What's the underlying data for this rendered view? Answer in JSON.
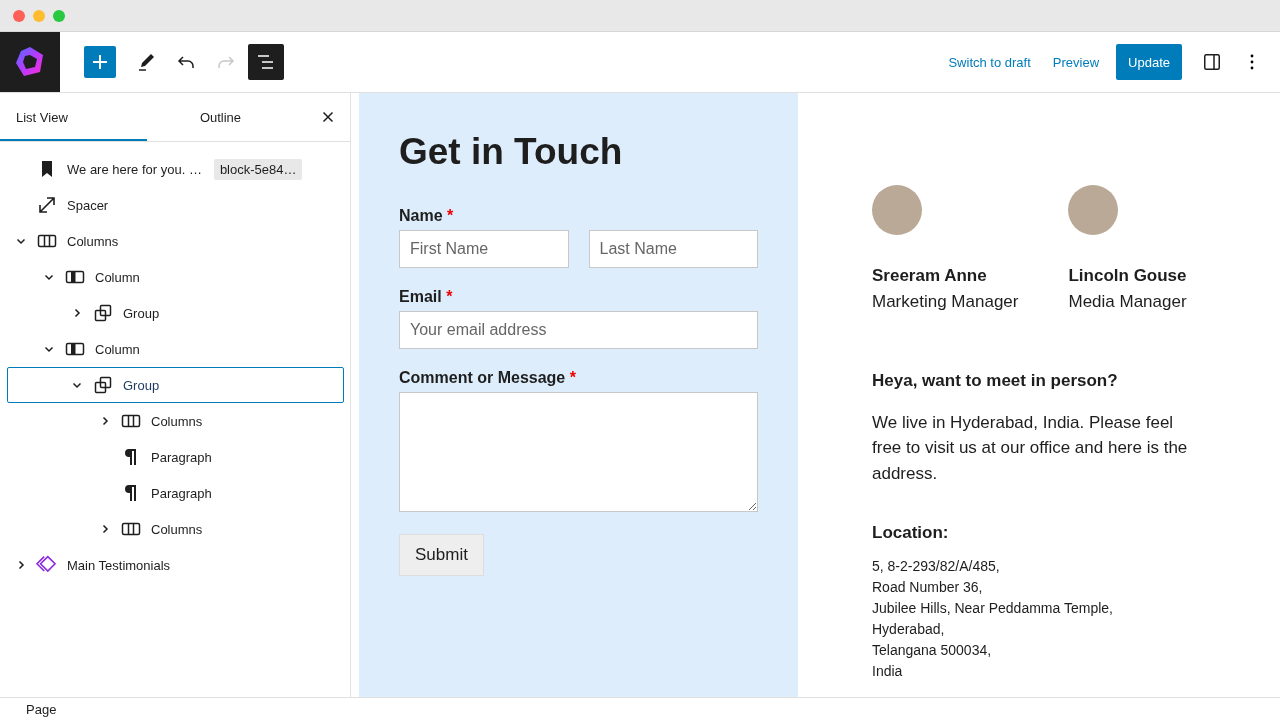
{
  "toolbar": {
    "list_view_active": true,
    "redo_disabled": true,
    "links": [
      "Switch to draft",
      "Preview"
    ],
    "primary_button": "Update"
  },
  "sidebar": {
    "tabs": [
      {
        "label": "List View",
        "selected": true
      },
      {
        "label": "Outline",
        "selected": false
      }
    ],
    "tree": [
      {
        "label": "We are here for you. …",
        "kind": "bookmark",
        "badge": "block-5e84…",
        "selected": false
      },
      {
        "label": "Spacer",
        "kind": "spacer",
        "selected": false
      },
      {
        "label": "Columns",
        "kind": "columns",
        "expanded": true,
        "selected": false,
        "children": [
          {
            "label": "Column",
            "kind": "column",
            "expanded": true,
            "selected": false,
            "children": [
              {
                "label": "Group",
                "kind": "group",
                "expanded": false,
                "selected": false
              }
            ]
          },
          {
            "label": "Column",
            "kind": "column",
            "expanded": true,
            "selected": false,
            "children": [
              {
                "label": "Group",
                "kind": "group",
                "expanded": true,
                "selected": true,
                "children": [
                  {
                    "label": "Columns",
                    "kind": "columns",
                    "expanded": false,
                    "selected": false
                  },
                  {
                    "label": "Paragraph",
                    "kind": "paragraph",
                    "selected": false
                  },
                  {
                    "label": "Paragraph",
                    "kind": "paragraph",
                    "selected": false
                  },
                  {
                    "label": "Columns",
                    "kind": "columns",
                    "expanded": false,
                    "selected": false
                  }
                ]
              }
            ]
          }
        ]
      },
      {
        "label": "Main Testimonials",
        "kind": "pattern",
        "expanded": false,
        "selected": false
      }
    ]
  },
  "form": {
    "title": "Get in Touch",
    "fields": [
      {
        "kind": "pair",
        "label": "Name",
        "required": true,
        "required_mark": "*",
        "placeholders": [
          "First Name",
          "Last Name"
        ]
      },
      {
        "kind": "text",
        "label": "Email",
        "required": true,
        "required_mark": "*",
        "placeholders": [
          "Your email address"
        ]
      },
      {
        "kind": "textarea",
        "label": "Comment or Message",
        "required": true,
        "required_mark": "*"
      }
    ],
    "submit": "Submit"
  },
  "people": [
    {
      "name": "Sreeram Anne",
      "role": "Marketing Manager"
    },
    {
      "name": "Lincoln Gouse",
      "role": "Media Manager"
    }
  ],
  "info": {
    "heading": "Heya, want to meet in person?",
    "paragraph": "We live in Hyderabad, India. Please feel free to visit us at our office and here is the address.",
    "location_heading": "Location:",
    "address": [
      "5, 8-2-293/82/A/485,",
      "Road Number 36,",
      "Jubilee Hills, Near Peddamma Temple,",
      "Hyderabad,",
      "Telangana 500034,",
      "India"
    ]
  },
  "status_bar": "Page"
}
